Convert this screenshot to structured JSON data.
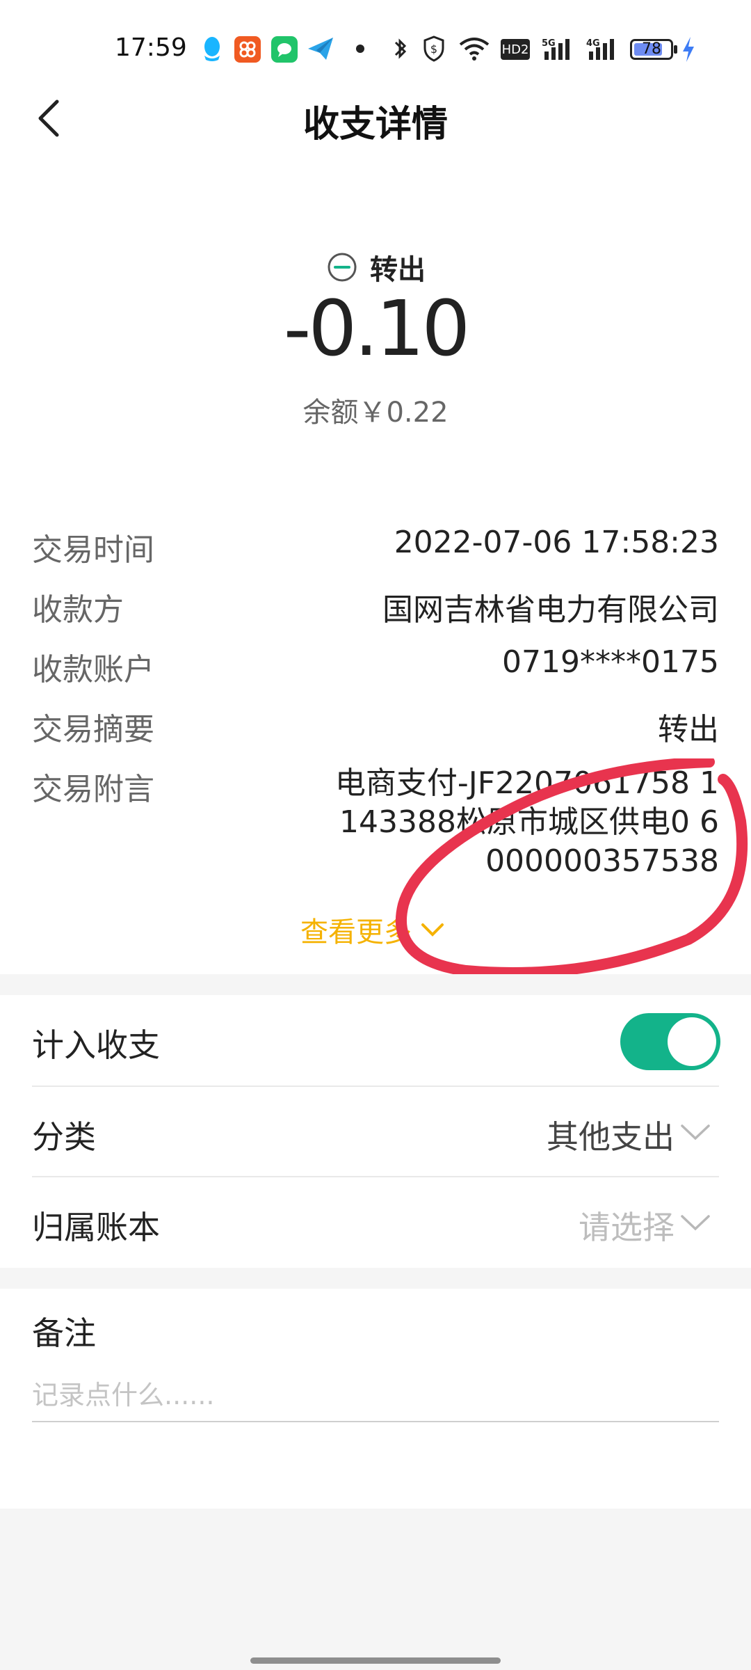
{
  "status_bar": {
    "time": "17:59",
    "hd_label": "HD2",
    "battery_level": "78",
    "battery_fraction": 0.78,
    "icons": [
      "qq-icon",
      "app-red-icon",
      "messages-icon",
      "plane-icon",
      "dot-icon",
      "bluetooth-icon",
      "shield-icon",
      "wifi-icon",
      "hd-icon",
      "5g-signal-icon",
      "4g-signal-icon",
      "battery-icon",
      "charging-icon"
    ]
  },
  "header": {
    "title": "收支详情",
    "back_icon": "chevron-left-icon"
  },
  "summary": {
    "type_label": "转出",
    "amount": "-0.10",
    "balance": "余额￥0.22"
  },
  "details": [
    {
      "label": "交易时间",
      "value": "2022-07-06 17:58:23"
    },
    {
      "label": "收款方",
      "value": "国网吉林省电力有限公司"
    },
    {
      "label": "收款账户",
      "value": "0719****0175"
    },
    {
      "label": "交易摘要",
      "value": "转出"
    },
    {
      "label": "交易附言",
      "value": "电商支付-JF2207061758 1143388松原市城区供电0 6000000357538"
    }
  ],
  "more_link": "查看更多",
  "settings": {
    "include_label": "计入收支",
    "include_on": true,
    "category_label": "分类",
    "category_value": "其他支出",
    "ledger_label": "归属账本",
    "ledger_value": "请选择"
  },
  "note": {
    "label": "备注",
    "placeholder": "记录点什么......"
  },
  "colors": {
    "accent_green": "#13b38a",
    "link_yellow": "#f5b200",
    "annotation_red": "#e8344e"
  }
}
